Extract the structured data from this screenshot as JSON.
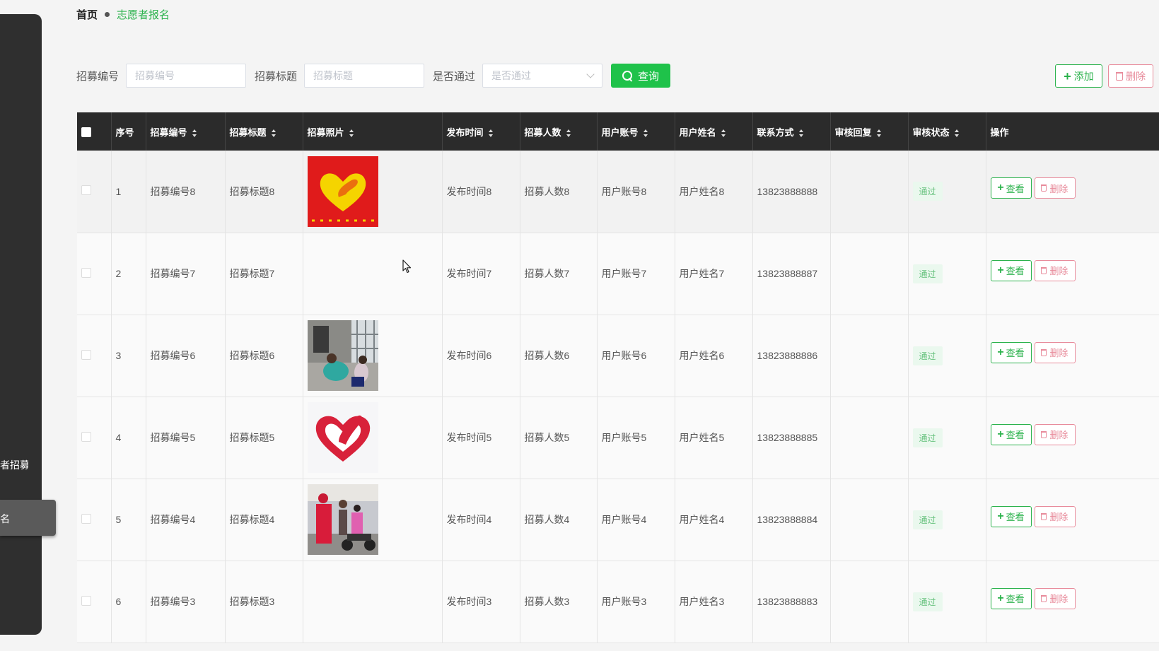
{
  "sidebar": {
    "items": [
      {
        "label": "志愿者招募"
      },
      {
        "label": "志愿者报名"
      }
    ]
  },
  "breadcrumb": {
    "home": "首页",
    "current": "志愿者报名"
  },
  "search": {
    "field1_label": "招募编号",
    "field1_placeholder": "招募编号",
    "field2_label": "招募标题",
    "field2_placeholder": "招募标题",
    "field3_label": "是否通过",
    "field3_placeholder": "是否通过",
    "query_label": "查询"
  },
  "toolbar": {
    "add_label": "添加",
    "delete_label": "删除"
  },
  "table": {
    "headers": [
      "序号",
      "招募编号",
      "招募标题",
      "招募照片",
      "发布时间",
      "招募人数",
      "用户账号",
      "用户姓名",
      "联系方式",
      "审核回复",
      "审核状态",
      "操作"
    ],
    "rows": [
      {
        "index": "1",
        "code": "招募编号8",
        "title": "招募标题8",
        "photo": "heart-red",
        "time": "发布时间8",
        "count": "招募人数8",
        "account": "用户账号8",
        "name": "用户姓名8",
        "phone": "13823888888",
        "reply": "",
        "status": "通过"
      },
      {
        "index": "2",
        "code": "招募编号7",
        "title": "招募标题7",
        "photo": "",
        "time": "发布时间7",
        "count": "招募人数7",
        "account": "用户账号7",
        "name": "用户姓名7",
        "phone": "13823888887",
        "reply": "",
        "status": "通过"
      },
      {
        "index": "3",
        "code": "招募编号6",
        "title": "招募标题6",
        "photo": "photo-room",
        "time": "发布时间6",
        "count": "招募人数6",
        "account": "用户账号6",
        "name": "用户姓名6",
        "phone": "13823888886",
        "reply": "",
        "status": "通过"
      },
      {
        "index": "4",
        "code": "招募编号5",
        "title": "招募标题5",
        "photo": "heart-white",
        "time": "发布时间5",
        "count": "招募人数5",
        "account": "用户账号5",
        "name": "用户姓名5",
        "phone": "13823888885",
        "reply": "",
        "status": "通过"
      },
      {
        "index": "5",
        "code": "招募编号4",
        "title": "招募标题4",
        "photo": "photo-street",
        "time": "发布时间4",
        "count": "招募人数4",
        "account": "用户账号4",
        "name": "用户姓名4",
        "phone": "13823888884",
        "reply": "",
        "status": "通过"
      },
      {
        "index": "6",
        "code": "招募编号3",
        "title": "招募标题3",
        "photo": "",
        "time": "发布时间3",
        "count": "招募人数3",
        "account": "用户账号3",
        "name": "用户姓名3",
        "phone": "13823888883",
        "reply": "",
        "status": "通过"
      }
    ],
    "view_label": "查看",
    "delete_label": "删除"
  },
  "colors": {
    "accent": "#1fc24a",
    "danger": "#e88b9b",
    "header_bg": "#2b2b2b",
    "sidebar_bg": "#2f2f2f"
  }
}
